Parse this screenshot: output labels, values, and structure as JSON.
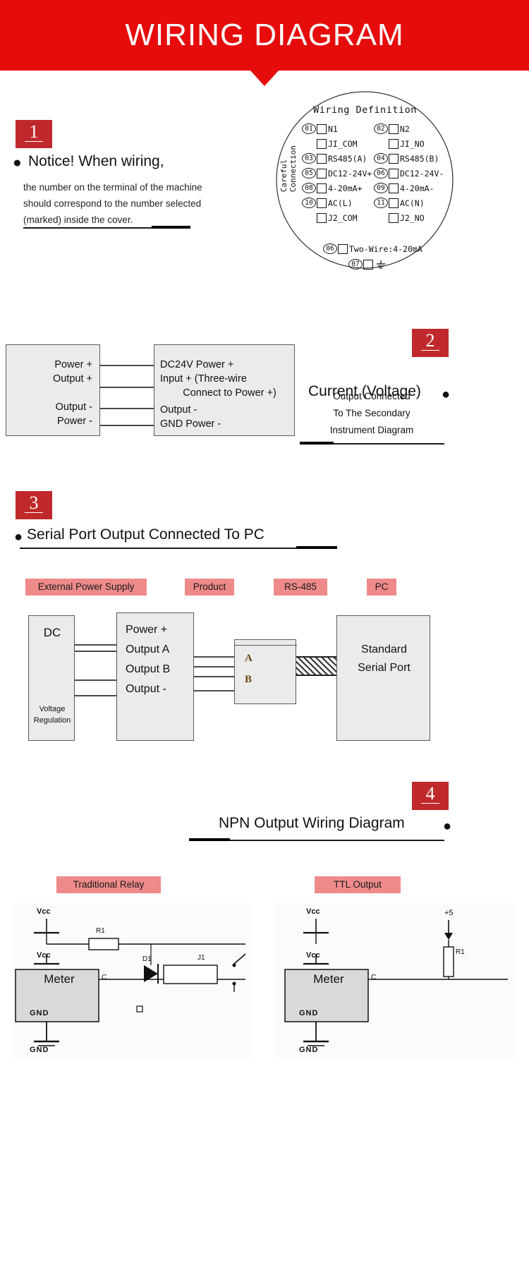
{
  "banner": {
    "title": "WIRING DIAGRAM",
    "color": "#e60c0c"
  },
  "accent": {
    "badge_red": "#c0292b",
    "tag_pink": "#ef8a8a",
    "box_fill": "#ebebeb"
  },
  "sections": {
    "one": {
      "number": "1",
      "heading": "Notice! When wiring,",
      "body_lines": [
        "the number on the terminal of the machine",
        "should correspond to the number selected",
        "(marked) inside the cover."
      ]
    },
    "two": {
      "number": "2",
      "title": "Current (Voltage)",
      "sub_lines": [
        "Output Connected",
        "To The Secondary",
        "Instrument Diagram"
      ],
      "left_box_lines": [
        "Power +",
        "Output +",
        "",
        "Output -",
        "Power -"
      ],
      "right_box_lines": [
        "DC24V Power +",
        "Input + (Three-wire",
        "        Connect to Power +)",
        "Output -",
        "GND Power -"
      ]
    },
    "three": {
      "number": "3",
      "title": "Serial Port Output Connected To PC",
      "tags": [
        "External Power Supply",
        "Product",
        "RS-485",
        "PC"
      ],
      "dc_box": {
        "title": "DC",
        "foot_line1": "Voltage",
        "foot_line2": "Regulation"
      },
      "product_box_lines": [
        "Power +",
        "Output A",
        "Output B",
        "Output -"
      ],
      "converter_labels": [
        "A",
        "B"
      ],
      "pc_box_lines": [
        "Standard",
        "Serial Port"
      ]
    },
    "four": {
      "number": "4",
      "title": "NPN Output Wiring Diagram",
      "tags": [
        "Traditional Relay",
        "TTL Output"
      ],
      "left_circuit": {
        "meter": "Meter",
        "vcc_top": "Vcc",
        "vcc_mid": "Vcc",
        "gnd_top": "GND",
        "gnd_bottom": "GND",
        "r1": "R1",
        "d1": "D1",
        "j1": "J1",
        "c": "C"
      },
      "right_circuit": {
        "meter": "Meter",
        "vcc_top": "Vcc",
        "vcc_mid": "Vcc",
        "gnd_top": "GND",
        "gnd_bottom": "GND",
        "plus5": "+5",
        "r1": "R1",
        "c": "C"
      }
    }
  },
  "wiring_definition": {
    "title": "Wiring Definition",
    "vertical_label_line1": "Careful",
    "vertical_label_line2": "Connection",
    "left_column": [
      {
        "num": "01",
        "label": "N1"
      },
      {
        "num": "",
        "label": "JI_COM"
      },
      {
        "num": "03",
        "label": "RS485(A)"
      },
      {
        "num": "05",
        "label": "DC12-24V+"
      },
      {
        "num": "08",
        "label": "4-20mA+"
      },
      {
        "num": "10",
        "label": "AC(L)"
      },
      {
        "num": "",
        "label": "J2_COM"
      }
    ],
    "right_column": [
      {
        "num": "02",
        "label": "N2"
      },
      {
        "num": "",
        "label": "JI_NO"
      },
      {
        "num": "04",
        "label": "RS485(B)"
      },
      {
        "num": "06",
        "label": "DC12-24V-"
      },
      {
        "num": "09",
        "label": "4-20mA-"
      },
      {
        "num": "11",
        "label": "AC(N)"
      },
      {
        "num": "",
        "label": "J2_NO"
      }
    ],
    "bottom_row": {
      "num": "06",
      "label": "Two-Wire:4-20mA"
    },
    "ground_row": {
      "num": "07",
      "label": ""
    }
  }
}
